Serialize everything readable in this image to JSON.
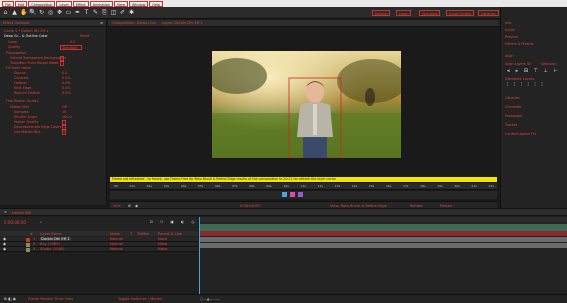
{
  "menu": [
    "File",
    "Edit",
    "Composition",
    "Layer",
    "Effect",
    "Animation",
    "View",
    "Window",
    "Help"
  ],
  "workspaces": [
    "Default",
    "Learn",
    "Standard",
    "Small Screen",
    "Libraries"
  ],
  "search_label": "Search Help",
  "left_panel": {
    "tab": "Effect Controls",
    "subtitle": "Comp 1 • Dorbin Dhi Eff 1",
    "effect_name": "Deep Gl... & Outline Color",
    "reset_label": "Reset",
    "rows": [
      {
        "label": "Grow",
        "value": "0.0"
      },
      {
        "label": "Quality",
        "value": "Standard"
      },
      {
        "label": "Propagation",
        "value": ""
      },
      {
        "label": "Extend Transparent Backgrounds",
        "value": ""
      },
      {
        "label": "Transition From Rough Matte",
        "value": ""
      },
      {
        "label": "Fill Inner Holes",
        "value": ""
      },
      {
        "label": "Source",
        "value": "0.0"
      },
      {
        "label": "Contrast",
        "value": "0.0%"
      },
      {
        "label": "Feather",
        "value": "0.0%"
      },
      {
        "label": "Shift Edge",
        "value": "0.0%"
      },
      {
        "label": "Reduce Chatter",
        "value": "0.0%"
      },
      {
        "label": "Fine Region Quality",
        "value": ""
      },
      {
        "label": "Motion Blur",
        "value": "Off"
      },
      {
        "label": "Samples",
        "value": "16"
      },
      {
        "label": "Shutter Angle",
        "value": "180.0"
      },
      {
        "label": "Higher Quality",
        "value": ""
      },
      {
        "label": "Decontaminate Edge Colors",
        "value": ""
      },
      {
        "label": "Use Motion Blur",
        "value": ""
      }
    ]
  },
  "viewer": {
    "tabs": [
      "Composition: Dorbin Dhi",
      "Layer: Dorbin Dhi Eff 1"
    ],
    "warning": "Frame not refreshed - to freeze, use Frame Free for Roto Brush & Refine Edge results at the composition to 20:21 for refresh the layer cache",
    "zoom": "50%",
    "timecode": "0:00:00:00",
    "view_label": "View: Roto Brush & Refine Edge",
    "render_label": "Render",
    "freeze_label": "Freeze",
    "ruler_ticks": [
      "00",
      "01s",
      "02s",
      "03s",
      "04s",
      "05s",
      "06s",
      "07s",
      "08s",
      "09s",
      "10s",
      "11s",
      "12s",
      "13s",
      "14s",
      "15s",
      "16s",
      "17s",
      "18s",
      "19s",
      "20s",
      "21s",
      "22s"
    ]
  },
  "right_panel": {
    "items": [
      "Info",
      "Audio",
      "Preview",
      "Effects & Presets",
      "Align",
      "Libraries",
      "Character",
      "Paragraph",
      "Tracker",
      "Content-Aware Fill"
    ],
    "align_label": "Align Layers To:",
    "distribute_label": "Distribute Layers:",
    "selection_label": "Selection"
  },
  "timeline": {
    "tab": "Dorbin Dhi",
    "timecode": "0:00:00:00",
    "columns": [
      "#",
      "Layer Name",
      "Mode",
      "T",
      "TrkMat",
      "Parent & Link"
    ],
    "layers": [
      {
        "num": "1",
        "name": "Dorbin Dhi Eff 1",
        "mode": "Normal",
        "parent": "None"
      },
      {
        "num": "2",
        "name": "Boy (1080)",
        "mode": "Normal",
        "parent": "None"
      },
      {
        "num": "3",
        "name": "Studio (1080)",
        "mode": "Normal",
        "parent": "None"
      }
    ]
  },
  "status": {
    "left": "Frame Render Time: 0ms",
    "mid": "Toggle Switches / Modes"
  },
  "colors": {
    "accent_red": "#e0463a",
    "warning_yellow": "#f2e600",
    "track_green": "#3f6b55",
    "track_gray": "#6b6b6b"
  }
}
